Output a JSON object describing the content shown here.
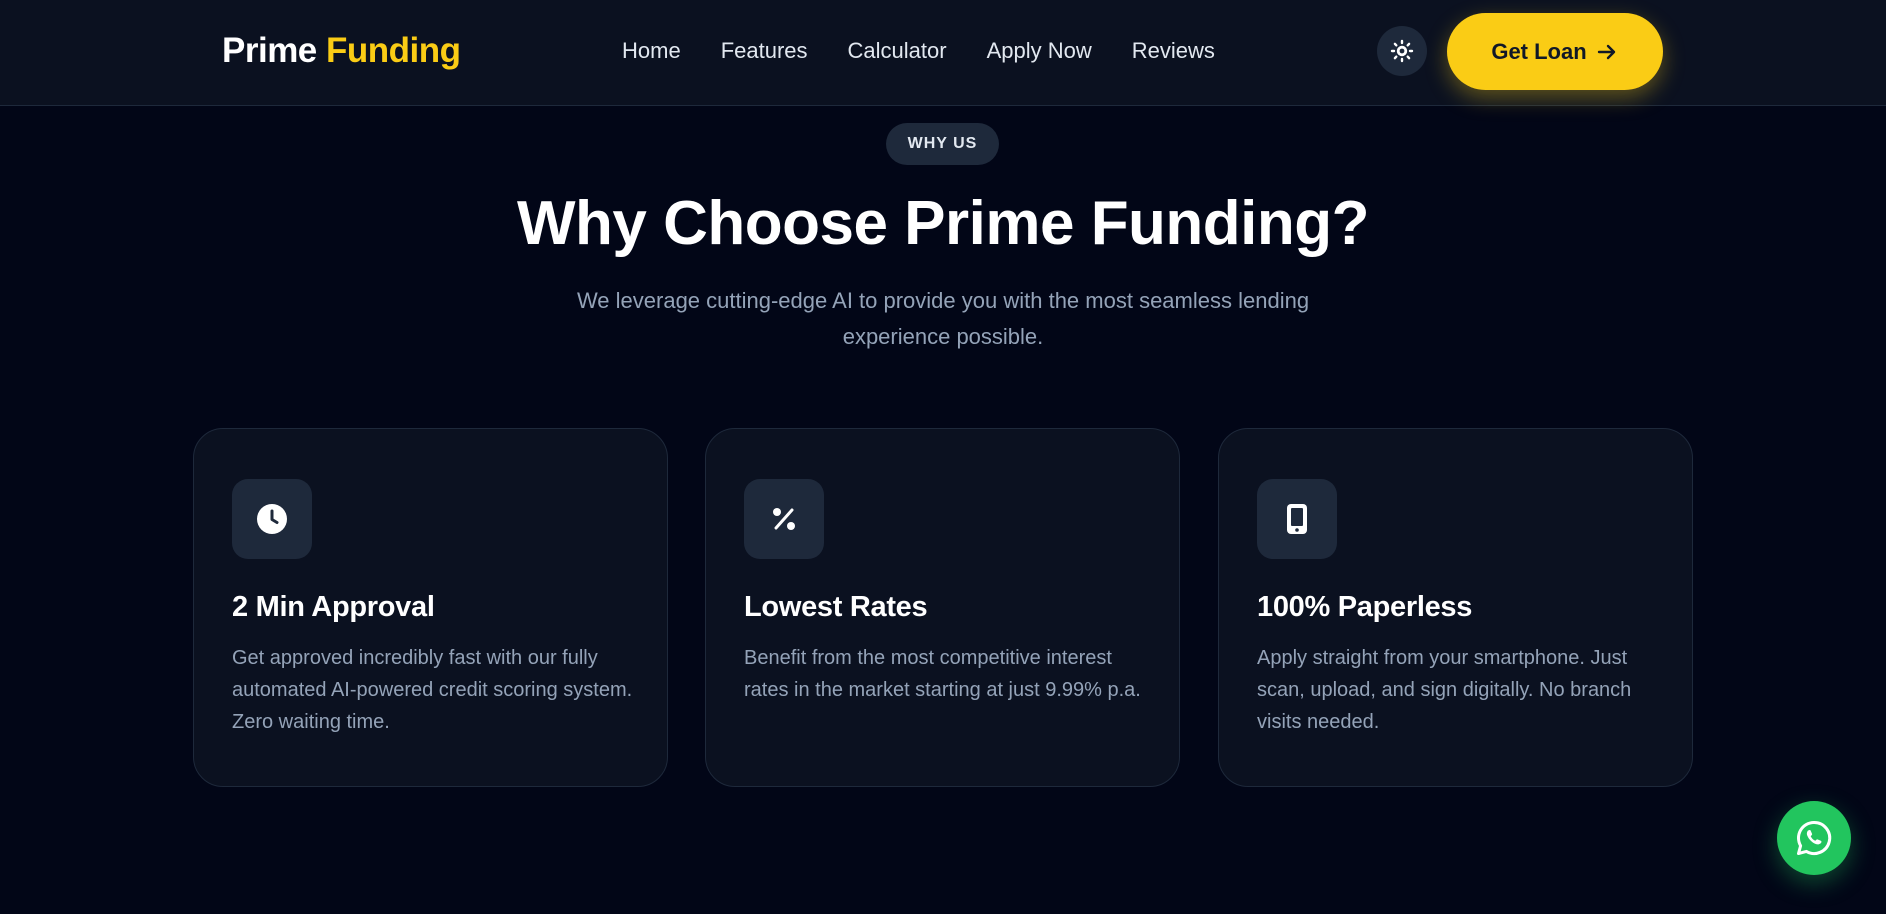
{
  "brand": {
    "part1": "Prime",
    "part2": "Funding"
  },
  "nav": {
    "items": [
      "Home",
      "Features",
      "Calculator",
      "Apply Now",
      "Reviews"
    ]
  },
  "header": {
    "theme_icon": "sun-icon",
    "cta_label": "Get Loan",
    "cta_icon": "arrow-right-icon"
  },
  "section": {
    "badge": "WHY US",
    "title": "Why Choose Prime Funding?",
    "subtitle": "We leverage cutting-edge AI to provide you with the most seamless lending experience possible."
  },
  "features": [
    {
      "icon": "clock-icon",
      "title": "2 Min Approval",
      "description": "Get approved incredibly fast with our fully automated AI-powered credit scoring system. Zero waiting time."
    },
    {
      "icon": "percent-icon",
      "title": "Lowest Rates",
      "description": "Benefit from the most competitive interest rates in the market starting at just 9.99% p.a."
    },
    {
      "icon": "smartphone-icon",
      "title": "100% Paperless",
      "description": "Apply straight from your smartphone. Just scan, upload, and sign digitally. No branch visits needed."
    }
  ],
  "floating": {
    "icon": "whatsapp-icon"
  },
  "colors": {
    "accent": "#facc15",
    "background": "#020617",
    "card": "#0b1120",
    "muted_text": "#94a3b8",
    "whatsapp": "#22c55e"
  }
}
